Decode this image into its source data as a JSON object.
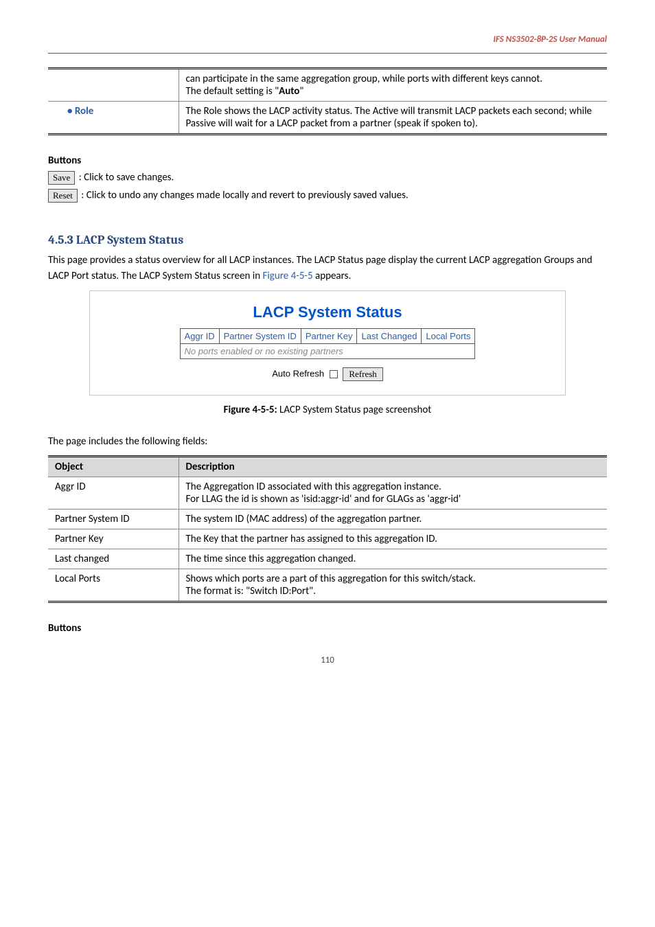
{
  "header": {
    "doc_title": "IFS  NS3502-8P-2S  User  Manual"
  },
  "table1": {
    "continuation": [
      "can participate in the same aggregation group, while ports with different keys cannot.",
      "The default setting is \"Auto\""
    ],
    "role_label": "Role",
    "role_desc": "The Role shows the LACP activity status. The Active will transmit LACP packets each second; while Passive will wait for a LACP packet from a partner (speak if spoken to)."
  },
  "buttons_heading": "Buttons",
  "buttons": {
    "save": {
      "label": "Save",
      "desc": ": Click to save changes."
    },
    "reset": {
      "label": "Reset",
      "desc": ": Click to undo any changes made locally and revert to previously saved values."
    }
  },
  "section": {
    "number": "4.5.3",
    "title": "LACP System Status",
    "para": "This page provides a status overview for all LACP instances. The LACP Status page display the current LACP aggregation Groups and LACP Port status. The LACP System Status screen in ",
    "fig_ref": "Figure 4-5-5",
    "para_tail": " appears."
  },
  "figure": {
    "title": "LACP System Status",
    "cols": [
      "Aggr ID",
      "Partner System ID",
      "Partner Key",
      "Last Changed",
      "Local Ports"
    ],
    "empty_row": "No ports enabled or no existing partners",
    "auto_refresh_label": "Auto Refresh",
    "refresh_btn": "Refresh"
  },
  "caption": {
    "bold": "Figure 4-5-5:",
    "rest": " LACP System Status page screenshot"
  },
  "fields_intro": "The page includes the following fields:",
  "fields_table": {
    "col_object": "Object",
    "col_desc": "Description",
    "rows": [
      {
        "label": "Aggr ID",
        "lines": [
          "The Aggregation ID associated with this aggregation instance.",
          "For LLAG the id is shown as 'isid:aggr-id' and for GLAGs as 'aggr-id'"
        ]
      },
      {
        "label": "Partner System ID",
        "lines": [
          "The system ID (MAC address) of the aggregation partner."
        ]
      },
      {
        "label": "Partner Key",
        "lines": [
          "The Key that the partner has assigned to this aggregation ID."
        ]
      },
      {
        "label": "Last changed",
        "lines": [
          "The time since this aggregation changed."
        ]
      },
      {
        "label": "Local Ports",
        "lines": [
          "Shows which ports are a part of this aggregation for this switch/stack.",
          "The format is: \"Switch ID:Port\"."
        ]
      }
    ]
  },
  "buttons_heading_2": "Buttons",
  "page_number": "110"
}
